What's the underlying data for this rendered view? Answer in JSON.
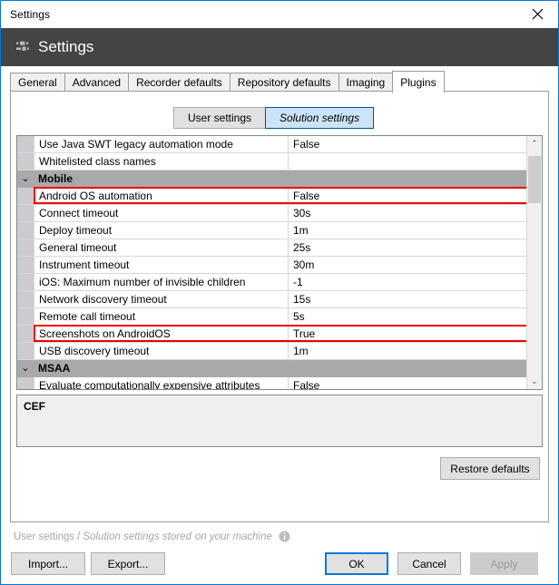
{
  "window": {
    "title": "Settings",
    "close_label": "✕"
  },
  "header": {
    "title": "Settings",
    "icon": "sliders-icon"
  },
  "tabs": [
    {
      "label": "General",
      "active": false
    },
    {
      "label": "Advanced",
      "active": false
    },
    {
      "label": "Recorder defaults",
      "active": false
    },
    {
      "label": "Repository defaults",
      "active": false
    },
    {
      "label": "Imaging",
      "active": false
    },
    {
      "label": "Plugins",
      "active": true
    }
  ],
  "segmented": {
    "user_label": "User settings",
    "solution_label": "Solution settings",
    "selected": "Solution settings"
  },
  "grid": {
    "rows": [
      {
        "type": "item",
        "name": "Use Java SWT legacy automation mode",
        "value": "False",
        "highlight": false
      },
      {
        "type": "item",
        "name": "Whitelisted class names",
        "value": "",
        "highlight": false
      },
      {
        "type": "group",
        "name": "Mobile",
        "value": "",
        "highlight": false,
        "expanded": true
      },
      {
        "type": "item",
        "name": "Android OS automation",
        "value": "False",
        "highlight": true
      },
      {
        "type": "item",
        "name": "Connect timeout",
        "value": "30s",
        "highlight": false
      },
      {
        "type": "item",
        "name": "Deploy timeout",
        "value": "1m",
        "highlight": false
      },
      {
        "type": "item",
        "name": "General timeout",
        "value": "25s",
        "highlight": false
      },
      {
        "type": "item",
        "name": "Instrument timeout",
        "value": "30m",
        "highlight": false
      },
      {
        "type": "item",
        "name": "iOS: Maximum number of invisible children",
        "value": "-1",
        "highlight": false
      },
      {
        "type": "item",
        "name": "Network discovery timeout",
        "value": "15s",
        "highlight": false
      },
      {
        "type": "item",
        "name": "Remote call timeout",
        "value": "5s",
        "highlight": false
      },
      {
        "type": "item",
        "name": "Screenshots on AndroidOS",
        "value": "True",
        "highlight": true
      },
      {
        "type": "item",
        "name": "USB discovery timeout",
        "value": "1m",
        "highlight": false
      },
      {
        "type": "group",
        "name": "MSAA",
        "value": "",
        "highlight": false,
        "expanded": true
      },
      {
        "type": "item",
        "name": "Evaluate computationally expensive attributes",
        "value": "False",
        "highlight": false
      }
    ],
    "expand_glyph": "⌄",
    "scrollbar": {
      "up_glyph": "⌃",
      "down_glyph": "⌄"
    }
  },
  "description": {
    "title": "CEF",
    "body": ""
  },
  "restore_defaults_label": "Restore defaults",
  "status": {
    "user_part": "User settings",
    "separator": "/",
    "solution_part": "Solution settings stored",
    "machine_part": "on your machine",
    "info_icon": "info-icon"
  },
  "footer": {
    "import_label": "Import...",
    "export_label": "Export...",
    "ok_label": "OK",
    "cancel_label": "Cancel",
    "apply_label": "Apply",
    "apply_enabled": false
  },
  "colors": {
    "window_border": "#0078d7",
    "header_band": "#444444",
    "group_row": "#a9a9a9",
    "highlight_red": "#ee0000",
    "accent_blue": "#0078d7",
    "selected_seg_bg": "#cce4f7"
  }
}
